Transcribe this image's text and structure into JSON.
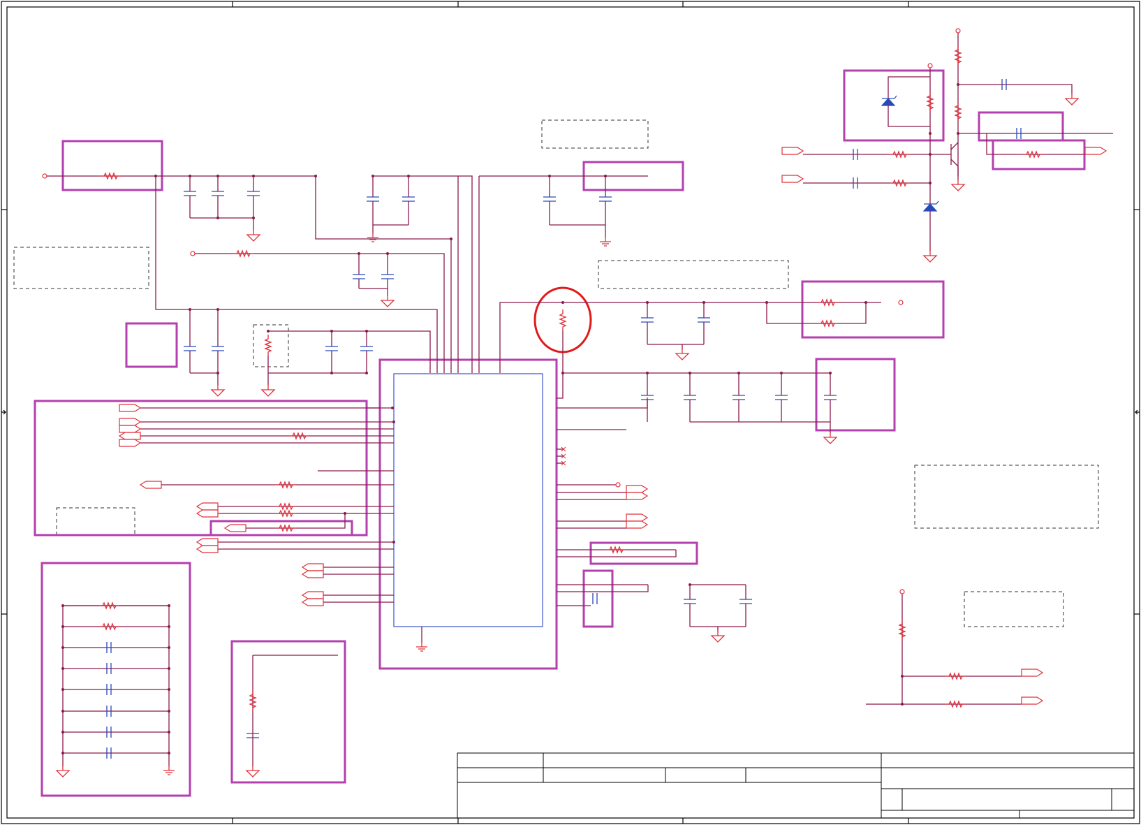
{
  "title_block": {
    "title": "",
    "document_number": "",
    "revision": "",
    "size": "",
    "date": "",
    "sheet": ""
  },
  "colors": {
    "frame": "#000000",
    "wire": "#8b1a4a",
    "component": "#e0303a",
    "outline": "#b43fae",
    "ic_inner": "#3a55c8",
    "capacitor": "#2a49b8",
    "diode": "#2a49b8",
    "highlight": "#e01a1a",
    "note_box": "#333333"
  },
  "icons": {
    "resistor": "resistor-icon",
    "capacitor": "capacitor-icon",
    "ground": "ground-icon",
    "diode": "diode-icon",
    "transistor": "transistor-icon",
    "port": "port-flag-icon"
  }
}
